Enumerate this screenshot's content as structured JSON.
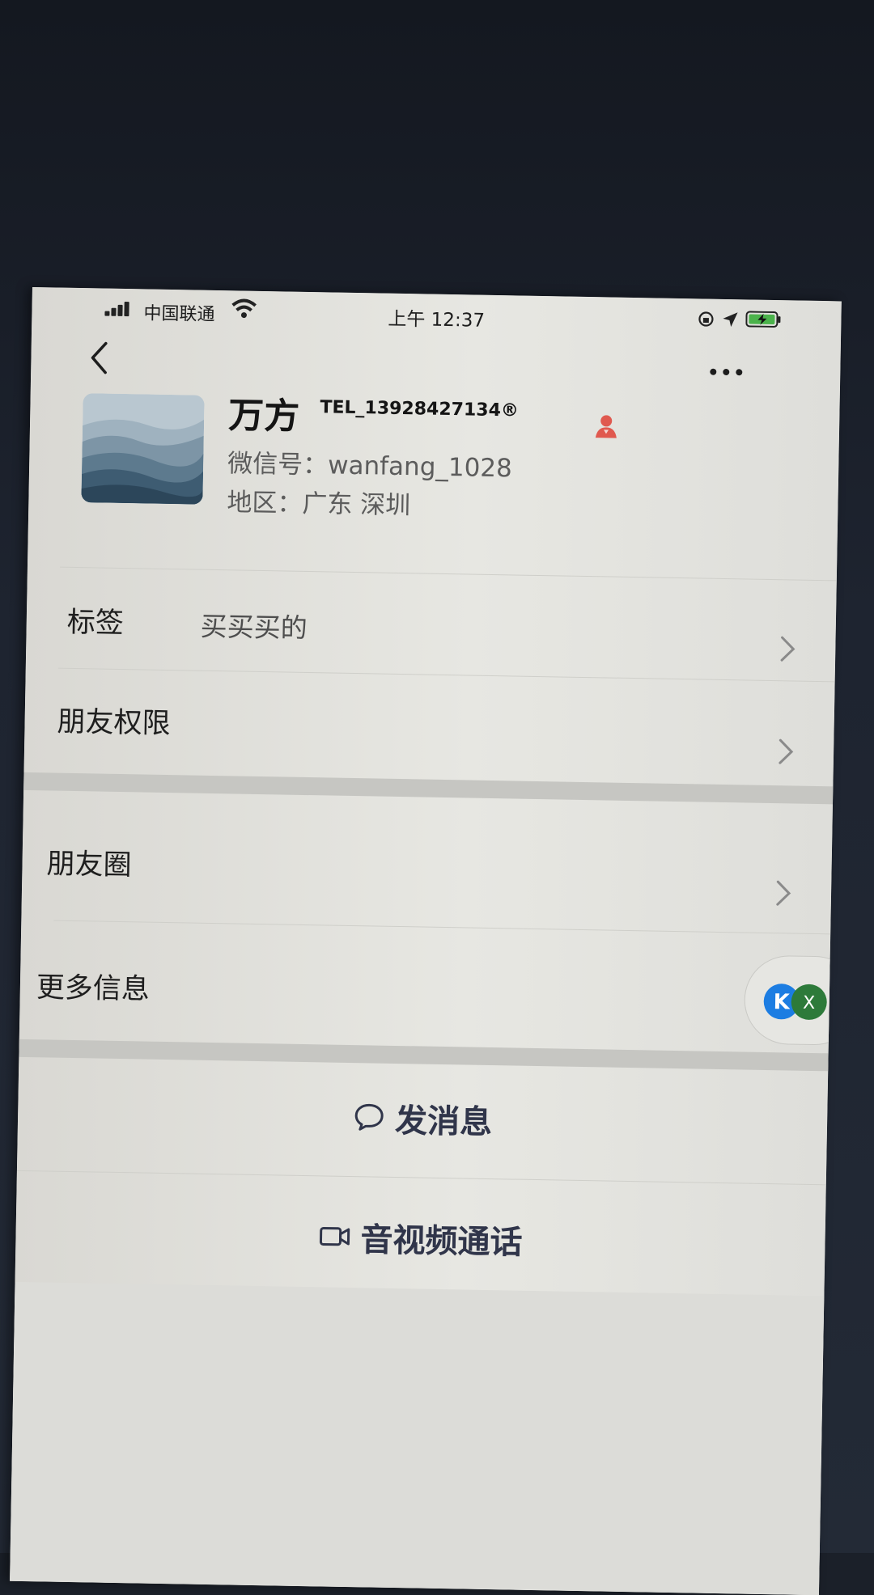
{
  "status_bar": {
    "carrier": "中国联通",
    "time": "上午 12:37",
    "icons": [
      "signal-icon",
      "wifi-icon",
      "rotation-lock-icon",
      "location-icon",
      "battery-charging-icon"
    ]
  },
  "nav": {
    "back_icon": "back-icon",
    "more_icon": "more-icon"
  },
  "profile": {
    "name": "万方",
    "tel": "TEL_13928427134®",
    "wechat_id": "微信号：wanfang_1028",
    "region": "地区：广东 深圳",
    "badge_icon": "star-person-icon"
  },
  "rows": {
    "tags_label": "标签",
    "tags_value": "买买买的",
    "permissions_label": "朋友权限",
    "moments_label": "朋友圈",
    "more_info_label": "更多信息"
  },
  "actions": {
    "message": "发消息",
    "call": "音视频通话"
  },
  "floating_widget": {
    "k_letter": "K",
    "x_letter": "X",
    "colors": {
      "k": "#1c7de2",
      "x": "#2d7a3a"
    }
  }
}
